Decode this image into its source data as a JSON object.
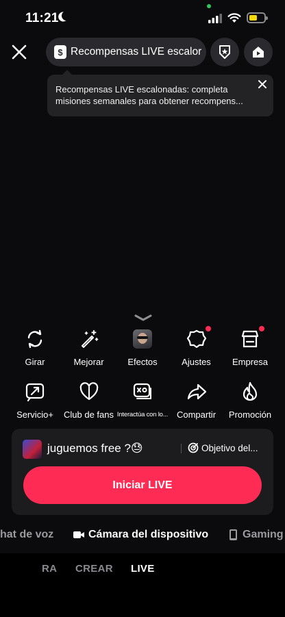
{
  "status_bar": {
    "time": "11:21",
    "battery_level": 0.55,
    "colors": {
      "battery": "#f5d90a",
      "privacy_dot": "#33c759"
    }
  },
  "header": {
    "rewards_label": "Recompensas LIVE escalor",
    "rewards_icon": "dollar-icon",
    "shield_icon": "star-shield-icon",
    "home_icon": "home-live-icon"
  },
  "tooltip": {
    "line1": "Recompensas LIVE escalonadas: completa",
    "line2": "misiones semanales para obtener recompens..."
  },
  "tools": {
    "row1": [
      {
        "label": "Girar",
        "icon": "flip-camera-icon",
        "badge": false
      },
      {
        "label": "Mejorar",
        "icon": "magic-wand-icon",
        "badge": false
      },
      {
        "label": "Efectos",
        "icon": "effect-thumbnail",
        "badge": false
      },
      {
        "label": "Ajustes",
        "icon": "settings-gear-icon",
        "badge": true
      },
      {
        "label": "Empresa",
        "icon": "store-icon",
        "badge": true
      }
    ],
    "row2": [
      {
        "label": "Servicio+",
        "icon": "service-arrow-icon"
      },
      {
        "label": "Club de fans",
        "icon": "heart-icon"
      },
      {
        "label": "Interactúa con lo...",
        "icon": "game-card-icon"
      },
      {
        "label": "Compartir",
        "icon": "share-arrow-icon"
      },
      {
        "label": "Promoción",
        "icon": "flame-icon"
      }
    ]
  },
  "panel": {
    "title": "juguemos free ?😓",
    "goal_label": "Objetivo del...",
    "start_label": "Iniciar LIVE"
  },
  "modes": {
    "left": "hat de voz",
    "center": "Cámara del dispositivo",
    "right": "Gaming"
  },
  "bottom_tabs": {
    "left": "RA",
    "middle": "CREAR",
    "active": "LIVE"
  },
  "colors": {
    "accent": "#fe2c55",
    "panel_bg": "#1c1c1f",
    "pill_bg": "#2a2a2e"
  }
}
